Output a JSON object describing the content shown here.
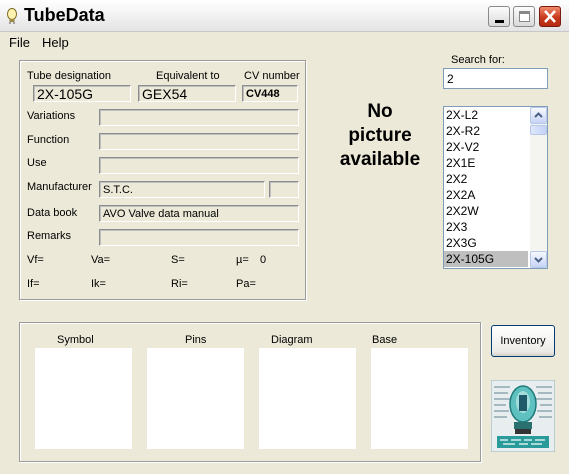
{
  "window": {
    "title": "TubeData",
    "controls": [
      "minimize",
      "maximize",
      "close"
    ]
  },
  "menu": {
    "file": "File",
    "help": "Help"
  },
  "info": {
    "tube_designation_label": "Tube designation",
    "equivalent_label": "Equivalent to",
    "cv_label": "CV number",
    "tube_designation": "2X-105G",
    "equivalent": "GEX54",
    "cv_number": "CV448",
    "variations_label": "Variations",
    "variations": "",
    "function_label": "Function",
    "function": "",
    "use_label": "Use",
    "use": "",
    "manufacturer_label": "Manufacturer",
    "manufacturer": "S.T.C.",
    "manufacturer_extra": "",
    "databook_label": "Data book",
    "databook": "AVO Valve data manual",
    "remarks_label": "Remarks",
    "remarks": "",
    "vf": "Vf=",
    "va": "Va=",
    "s": "S=",
    "mu": "µ=",
    "mu_value": "0",
    "if": "If=",
    "ik": "Ik=",
    "ri": "Ri=",
    "pa": "Pa="
  },
  "picture": {
    "no_picture_line1": "No",
    "no_picture_line2": "picture",
    "no_picture_line3": "available"
  },
  "search": {
    "label": "Search for:",
    "value": "2"
  },
  "list": {
    "items": [
      "2X-L2",
      "2X-R2",
      "2X-V2",
      "2X1E",
      "2X2",
      "2X2A",
      "2X2W",
      "2X3",
      "2X3G",
      "2X-105G"
    ],
    "selected_index": 9
  },
  "bottom": {
    "symbol": "Symbol",
    "pins": "Pins",
    "diagram": "Diagram",
    "base": "Base"
  },
  "buttons": {
    "inventory": "Inventory"
  },
  "colors": {
    "window_bg": "#ece9d8",
    "close_red": "#c8391d",
    "scroll_blue": "#c6d3f7",
    "logo_teal": "#2a9b9b"
  }
}
